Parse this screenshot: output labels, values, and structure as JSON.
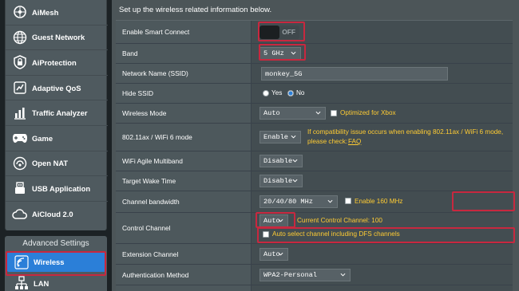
{
  "sidebar": {
    "items": [
      {
        "label": "AiMesh",
        "icon": "aimesh-icon"
      },
      {
        "label": "Guest Network",
        "icon": "guest-network-icon"
      },
      {
        "label": "AiProtection",
        "icon": "aiprotection-icon"
      },
      {
        "label": "Adaptive QoS",
        "icon": "adaptive-qos-icon"
      },
      {
        "label": "Traffic Analyzer",
        "icon": "traffic-analyzer-icon"
      },
      {
        "label": "Game",
        "icon": "game-controller-icon"
      },
      {
        "label": "Open NAT",
        "icon": "open-nat-icon"
      },
      {
        "label": "USB Application",
        "icon": "usb-icon"
      },
      {
        "label": "AiCloud 2.0",
        "icon": "aicloud-icon"
      }
    ],
    "advanced_title": "Advanced Settings",
    "advanced_items": [
      {
        "label": "Wireless",
        "icon": "wireless-icon",
        "selected": true
      },
      {
        "label": "LAN",
        "icon": "lan-icon"
      }
    ]
  },
  "main": {
    "intro": "Set up the wireless related information below.",
    "rows": {
      "smart_connect": {
        "label": "Enable Smart Connect",
        "toggle_text": "OFF"
      },
      "band": {
        "label": "Band",
        "value": "5 GHz"
      },
      "ssid": {
        "label": "Network Name (SSID)",
        "value": "monkey_5G"
      },
      "hide_ssid": {
        "label": "Hide SSID",
        "yes": "Yes",
        "no": "No",
        "selected": "No"
      },
      "wireless_mode": {
        "label": "Wireless Mode",
        "value": "Auto",
        "checkbox_label": "Optimized for Xbox"
      },
      "wifi6_mode": {
        "label": "802.11ax / WiFi 6 mode",
        "value": "Enable",
        "note_line1": "If compatibility issue occurs when enabling 802.11ax / WiFi 6 mode,",
        "note_line2": "please check:",
        "faq": "FAQ"
      },
      "agile_multiband": {
        "label": "WiFi Agile Multiband",
        "value": "Disable"
      },
      "target_wake_time": {
        "label": "Target Wake Time",
        "value": "Disable"
      },
      "channel_bandwidth": {
        "label": "Channel bandwidth",
        "value": "20/40/80 MHz",
        "checkbox_label": "Enable 160 MHz"
      },
      "control_channel": {
        "label": "Control Channel",
        "value": "Auto",
        "current_text": "Current Control Channel: 100",
        "dfs_label": "Auto select channel including DFS channels"
      },
      "extension_channel": {
        "label": "Extension Channel",
        "value": "Auto"
      },
      "auth_method": {
        "label": "Authentication Method",
        "value": "WPA2-Personal"
      }
    }
  },
  "colors": {
    "highlight": "#c8283f",
    "accent_blue": "#2b7fd8",
    "note_yellow": "#ffcc33"
  }
}
